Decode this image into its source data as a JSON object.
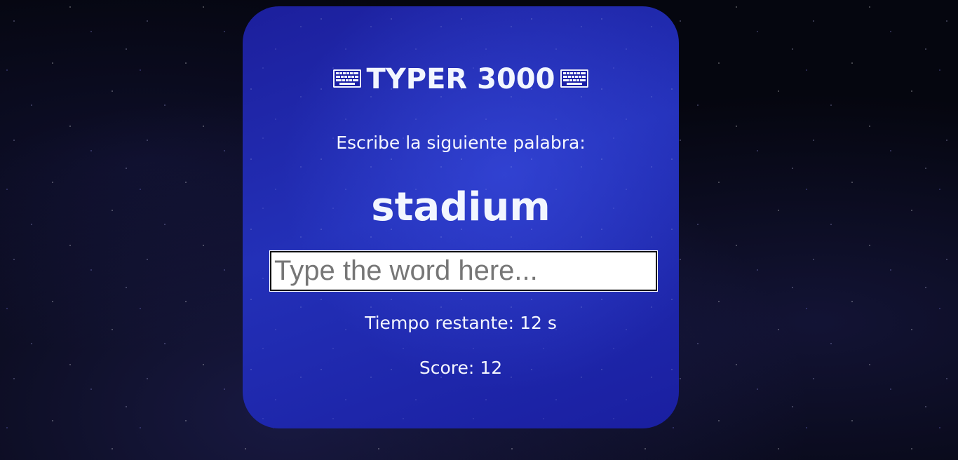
{
  "game": {
    "title": "TYPER 3000",
    "title_icon": "keyboard-icon",
    "instruction": "Escribe la siguiente palabra:",
    "current_word": "stadium",
    "input_value": "",
    "input_placeholder": "Type the word here...",
    "time_label": "Tiempo restante:",
    "time_value": "12 s",
    "score_label": "Score:",
    "score_value": "12"
  },
  "colors": {
    "card_background": "#1b1fa6",
    "text": "#f2f6ff",
    "page_background": "#05060f"
  }
}
